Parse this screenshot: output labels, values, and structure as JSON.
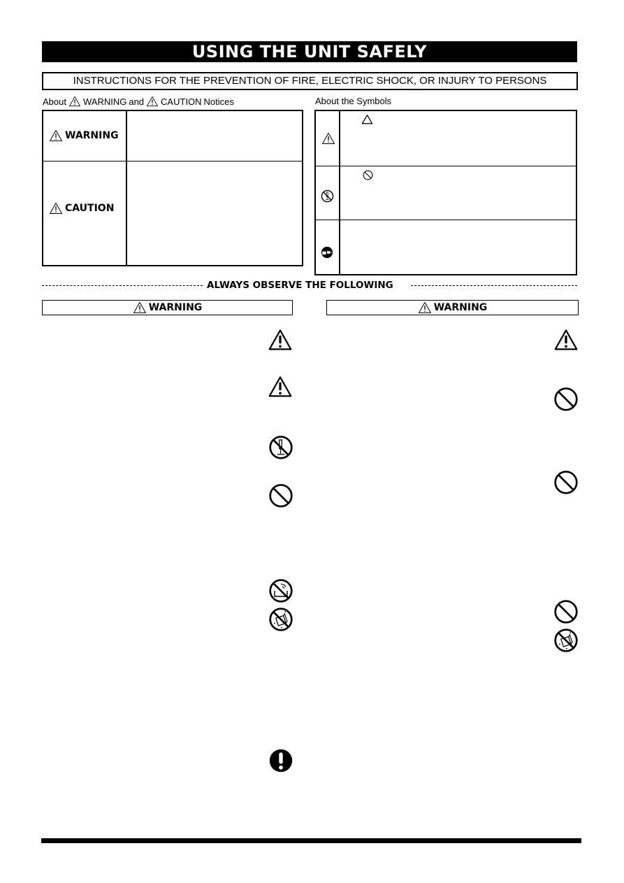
{
  "header": {
    "title": "USING THE UNIT SAFELY",
    "subtitle": "INSTRUCTIONS FOR THE PREVENTION OF FIRE, ELECTRIC SHOCK, OR INJURY TO PERSONS"
  },
  "notices_section": {
    "label_prefix": "About",
    "label_warning": "WARNING",
    "label_and": "and",
    "label_caution": "CAUTION",
    "label_suffix": "Notices",
    "rows": [
      {
        "label": "WARNING",
        "text": ""
      },
      {
        "label": "CAUTION",
        "text": ""
      }
    ]
  },
  "symbols_section": {
    "label": "About the Symbols",
    "rows": [
      {
        "icon": "warning-triangle-icon",
        "inline_icon": "triangle-outline-icon",
        "text": ""
      },
      {
        "icon": "do-not-disassemble-icon",
        "inline_icon": "prohibition-icon",
        "text": ""
      },
      {
        "icon": "unplug-icon",
        "inline_icon": "",
        "text": ""
      }
    ]
  },
  "observe": {
    "heading": "ALWAYS OBSERVE THE FOLLOWING",
    "left_column": {
      "heading": "WARNING",
      "icons": [
        "warning-triangle-icon",
        "warning-triangle-icon",
        "do-not-disassemble-icon",
        "prohibition-icon",
        "no-water-bath-icon",
        "no-liquid-icon",
        "mandatory-action-icon"
      ]
    },
    "right_column": {
      "heading": "WARNING",
      "icons": [
        "warning-triangle-icon",
        "prohibition-icon",
        "prohibition-icon",
        "prohibition-icon",
        "no-liquid-icon"
      ]
    }
  },
  "colors": {
    "ink": "#000000",
    "paper": "#ffffff"
  }
}
